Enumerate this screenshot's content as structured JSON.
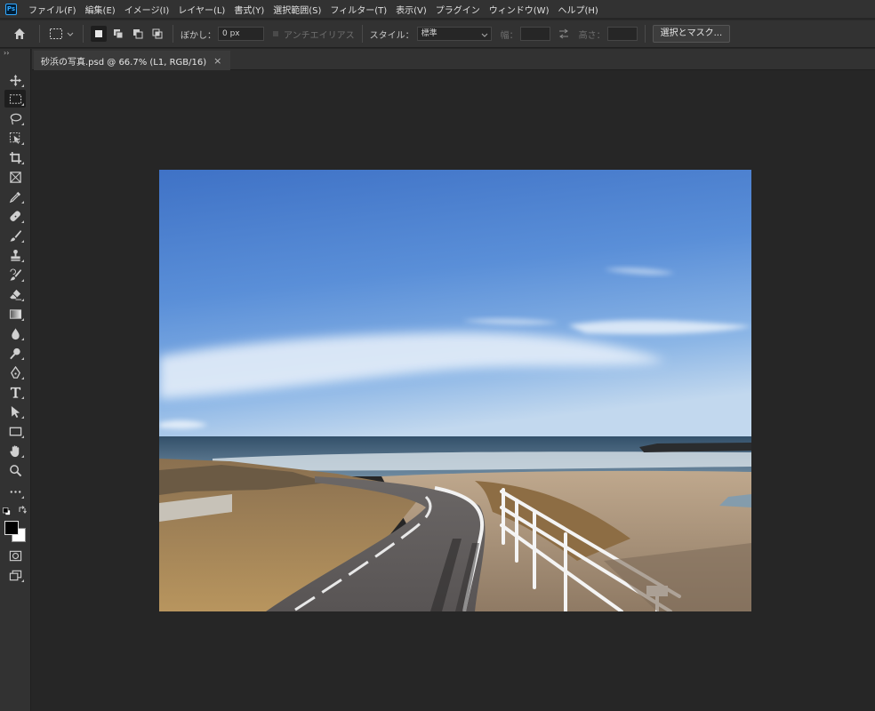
{
  "app": {
    "logo_text": "Ps"
  },
  "menu": [
    "ファイル(F)",
    "編集(E)",
    "イメージ(I)",
    "レイヤー(L)",
    "書式(Y)",
    "選択範囲(S)",
    "フィルター(T)",
    "表示(V)",
    "プラグイン",
    "ウィンドウ(W)",
    "ヘルプ(H)"
  ],
  "options": {
    "feather_label": "ぼかし：",
    "feather_value": "0 px",
    "antialias_label": "アンチエイリアス",
    "style_label": "スタイル：",
    "style_value": "標準",
    "width_label": "幅：",
    "height_label": "高さ：",
    "select_mask_button": "選択とマスク..."
  },
  "document": {
    "tab_title": "砂浜の写真.psd @ 66.7% (L1, RGB/16)",
    "close_glyph": "×"
  },
  "toolbar": {
    "collapse_glyph": "››"
  },
  "icons": {
    "home": "home-icon",
    "marquee": "rect-marquee-icon",
    "move": "move-icon",
    "lasso": "lasso-icon",
    "crop": "crop-icon",
    "frame": "frame-icon",
    "eyedropper": "eyedropper-icon",
    "healing": "healing-brush-icon",
    "brush": "brush-icon",
    "stamp": "clone-stamp-icon",
    "history_brush": "history-brush-icon",
    "eraser": "eraser-icon",
    "gradient": "gradient-icon",
    "blur": "blur-icon",
    "dodge": "dodge-icon",
    "pen": "pen-icon",
    "type": "type-icon",
    "path_select": "path-selection-icon",
    "rectangle": "rectangle-shape-icon",
    "hand": "hand-icon",
    "zoom": "zoom-icon",
    "more": "more-tools-icon",
    "swap": "swap-colors-icon",
    "quick_mask": "quick-mask-icon",
    "screen_mode": "screen-mode-icon"
  },
  "colors": {
    "foreground": "#000000",
    "background": "#ffffff",
    "accent": "#31a8ff"
  }
}
